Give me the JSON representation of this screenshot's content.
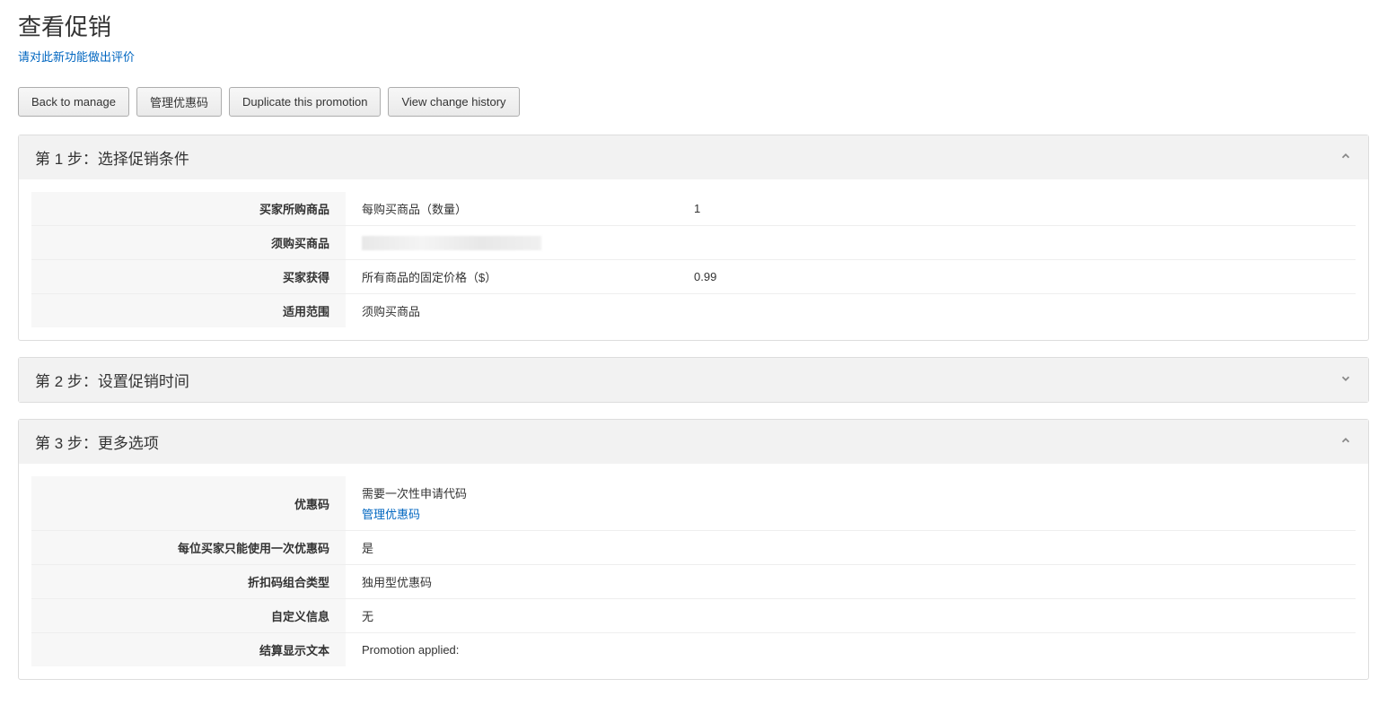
{
  "header": {
    "title": "查看促销",
    "rate_link": "请对此新功能做出评价"
  },
  "buttons": {
    "back": "Back to manage",
    "manage_coupon": "管理优惠码",
    "duplicate": "Duplicate this promotion",
    "history": "View change history"
  },
  "step1": {
    "title": "第 1 步：选择促销条件",
    "rows": {
      "buyer_purchase": {
        "label": "买家所购商品",
        "value1": "每购买商品（数量）",
        "value2": "1"
      },
      "must_buy": {
        "label": "须购买商品"
      },
      "buyer_gets": {
        "label": "买家获得",
        "value1": "所有商品的固定价格（$）",
        "value2": "0.99"
      },
      "applies_to": {
        "label": "适用范围",
        "value1": "须购买商品"
      }
    }
  },
  "step2": {
    "title": "第 2 步：设置促销时间"
  },
  "step3": {
    "title": "第 3 步：更多选项",
    "rows": {
      "coupon_code": {
        "label": "优惠码",
        "value1": "需要一次性申请代码",
        "link": "管理优惠码"
      },
      "once_per_buyer": {
        "label": "每位买家只能使用一次优惠码",
        "value1": "是"
      },
      "combo_type": {
        "label": "折扣码组合类型",
        "value1": "独用型优惠码"
      },
      "custom_info": {
        "label": "自定义信息",
        "value1": "无"
      },
      "checkout_text": {
        "label": "结算显示文本",
        "value1": "Promotion applied:"
      }
    }
  }
}
